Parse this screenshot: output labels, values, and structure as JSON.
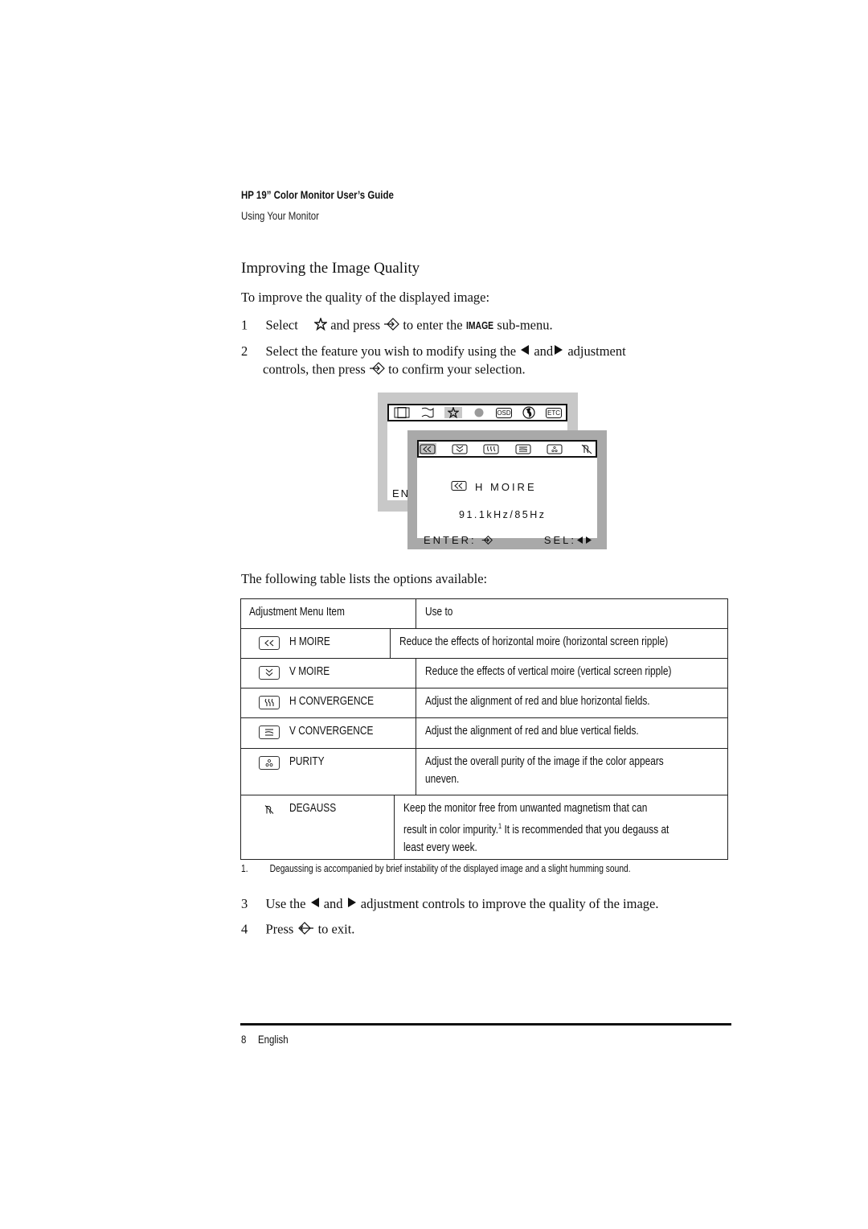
{
  "header": {
    "title": "HP 19” Color Monitor User’s Guide",
    "subtitle": "Using Your Monitor"
  },
  "section": {
    "title": "Improving the Image Quality",
    "intro": "To improve the quality of the displayed image:"
  },
  "steps": [
    {
      "num": "1",
      "parts": [
        "Select",
        "and press",
        "to enter the",
        "IMAGE",
        "sub-menu."
      ]
    },
    {
      "num": "2",
      "line1_parts": [
        "Select the feature you wish to modify using the",
        "and",
        "adjustment"
      ],
      "line2_parts": [
        "controls, then press",
        "to confirm your selection."
      ]
    },
    {
      "num": "3",
      "parts": [
        "Use the",
        "and",
        "adjustment controls to improve the quality of the image."
      ]
    },
    {
      "num": "4",
      "parts": [
        "Press",
        "to exit."
      ]
    }
  ],
  "osd": {
    "main_menu_icons": [
      "geometry-icon",
      "size-position-icon",
      "image-star-icon",
      "color-icon",
      "osd-icon",
      "language-globe-icon",
      "etc-icon"
    ],
    "main_menu_labels": {
      "osd": "OSD",
      "etc": "ETC"
    },
    "main_menu_selected": "image-star-icon",
    "back_enter_partial": "EN",
    "submenu_icons": [
      "h-moire-icon",
      "v-moire-icon",
      "h-convergence-icon",
      "v-convergence-icon",
      "purity-icon",
      "degauss-icon"
    ],
    "submenu_selected": "h-moire-icon",
    "current_item": "H MOIRE",
    "frequency": "91.1kHz/85Hz",
    "enter_label": "ENTER:",
    "sel_label": "SEL:"
  },
  "table_intro": "The following table lists the options available:",
  "table": {
    "headers": [
      "Adjustment Menu Item",
      "Use to"
    ],
    "rows": [
      {
        "icon": "h-moire-icon",
        "item": "H MOIRE",
        "use": "Reduce the effects of horizontal moire (horizontal screen ripple)"
      },
      {
        "icon": "v-moire-icon",
        "item": "V MOIRE",
        "use": "Reduce the effects of vertical moire (vertical screen ripple)"
      },
      {
        "icon": "h-convergence-icon",
        "item": "H CONVERGENCE",
        "use": "Adjust the alignment of red and blue horizontal fields."
      },
      {
        "icon": "v-convergence-icon",
        "item": "V CONVERGENCE",
        "use": "Adjust the alignment of red and blue vertical fields."
      },
      {
        "icon": "purity-icon",
        "item": "PURITY",
        "use_lines": [
          "Adjust the overall purity of the image if the color appears",
          "uneven."
        ]
      },
      {
        "icon": "degauss-icon",
        "item": "DEGAUSS",
        "use_lines": [
          "Keep the monitor free from unwanted magnetism that can",
          "result in color impurity.",
          "It is recommended that you degauss at",
          "least every week."
        ],
        "footnote_ref": "1"
      }
    ]
  },
  "footnote": {
    "num": "1.",
    "text": "Degaussing is accompanied by brief instability of the displayed image and a slight humming sound."
  },
  "footer": {
    "page": "8",
    "language": "English"
  }
}
